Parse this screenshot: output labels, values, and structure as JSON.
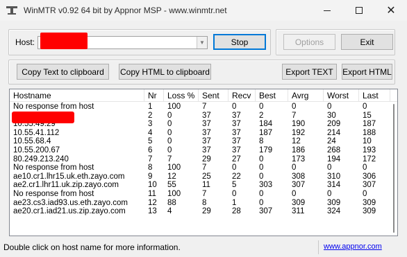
{
  "window": {
    "title": "WinMTR v0.92 64 bit by Appnor MSP - www.winmtr.net",
    "icon": "winmtr-app-icon"
  },
  "host": {
    "label": "Host:",
    "value": ""
  },
  "buttons": {
    "stop": "Stop",
    "options": "Options",
    "exit": "Exit",
    "copy_text": "Copy Text to clipboard",
    "copy_html": "Copy HTML to clipboard",
    "export_text": "Export TEXT",
    "export_html": "Export HTML"
  },
  "table": {
    "columns": [
      "Hostname",
      "Nr",
      "Loss %",
      "Sent",
      "Recv",
      "Best",
      "Avrg",
      "Worst",
      "Last"
    ],
    "rows": [
      [
        "No response from host",
        "1",
        "100",
        "7",
        "0",
        "0",
        "0",
        "0",
        "0"
      ],
      [
        "",
        "2",
        "0",
        "37",
        "37",
        "2",
        "7",
        "30",
        "15"
      ],
      [
        "10.55.49.29",
        "3",
        "0",
        "37",
        "37",
        "184",
        "190",
        "209",
        "187"
      ],
      [
        "10.55.41.112",
        "4",
        "0",
        "37",
        "37",
        "187",
        "192",
        "214",
        "188"
      ],
      [
        "10.55.68.4",
        "5",
        "0",
        "37",
        "37",
        "8",
        "12",
        "24",
        "10"
      ],
      [
        "10.55.200.67",
        "6",
        "0",
        "37",
        "37",
        "179",
        "186",
        "268",
        "193"
      ],
      [
        "80.249.213.240",
        "7",
        "7",
        "29",
        "27",
        "0",
        "173",
        "194",
        "172"
      ],
      [
        "No response from host",
        "8",
        "100",
        "7",
        "0",
        "0",
        "0",
        "0",
        "0"
      ],
      [
        "ae10.cr1.lhr15.uk.eth.zayo.com",
        "9",
        "12",
        "25",
        "22",
        "0",
        "308",
        "310",
        "306"
      ],
      [
        "ae2.cr1.lhr11.uk.zip.zayo.com",
        "10",
        "55",
        "11",
        "5",
        "303",
        "307",
        "314",
        "307"
      ],
      [
        "No response from host",
        "11",
        "100",
        "7",
        "0",
        "0",
        "0",
        "0",
        "0"
      ],
      [
        "ae23.cs3.iad93.us.eth.zayo.com",
        "12",
        "88",
        "8",
        "1",
        "0",
        "309",
        "309",
        "309"
      ],
      [
        "ae20.cr1.iad21.us.zip.zayo.com",
        "13",
        "4",
        "29",
        "28",
        "307",
        "311",
        "324",
        "309"
      ]
    ]
  },
  "status": {
    "text": "Double click on host name for more information.",
    "link": "www.appnor.com"
  },
  "colors": {
    "redaction": "#ff0000",
    "link": "#0000ee",
    "default_button_border": "#0078d7"
  }
}
